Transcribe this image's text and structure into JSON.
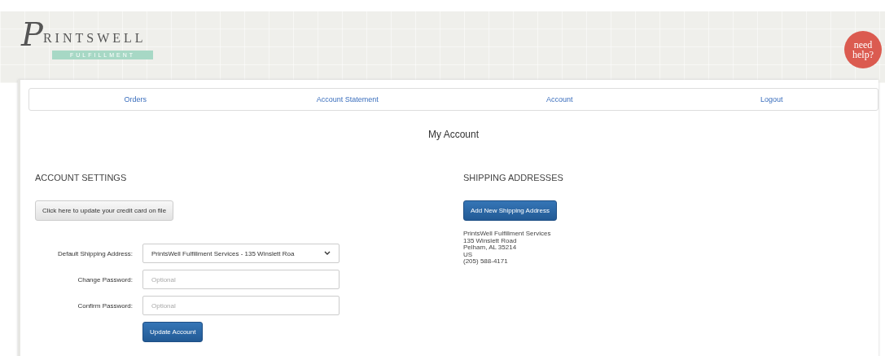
{
  "logo": {
    "initial": "P",
    "name": "RINTSWELL",
    "tagline": "FULFILLMENT"
  },
  "help_badge": {
    "line1": "need",
    "line2": "help?"
  },
  "nav": [
    {
      "label": "Orders"
    },
    {
      "label": "Account Statement"
    },
    {
      "label": "Account"
    },
    {
      "label": "Logout"
    }
  ],
  "page_title": "My Account",
  "account_settings": {
    "heading": "ACCOUNT SETTINGS",
    "credit_card_button": "Click here to update your credit card on file",
    "fields": [
      {
        "kind": "select",
        "label": "Default Shipping Address:",
        "value": "PrintsWell Fulfillment Services - 135 Winslett Roa"
      },
      {
        "kind": "password",
        "label": "Change Password:",
        "placeholder": "Optional"
      },
      {
        "kind": "password",
        "label": "Confirm Password:",
        "placeholder": "Optional"
      }
    ],
    "submit_button": "Update Account"
  },
  "shipping_addresses": {
    "heading": "SHIPPING ADDRESSES",
    "add_button": "Add New Shipping Address",
    "address_lines": [
      "PrintsWell Fulfillment Services",
      "135 Winslett Road",
      "Pelham, AL 35214",
      "US",
      "(205) 588-4171"
    ]
  }
}
